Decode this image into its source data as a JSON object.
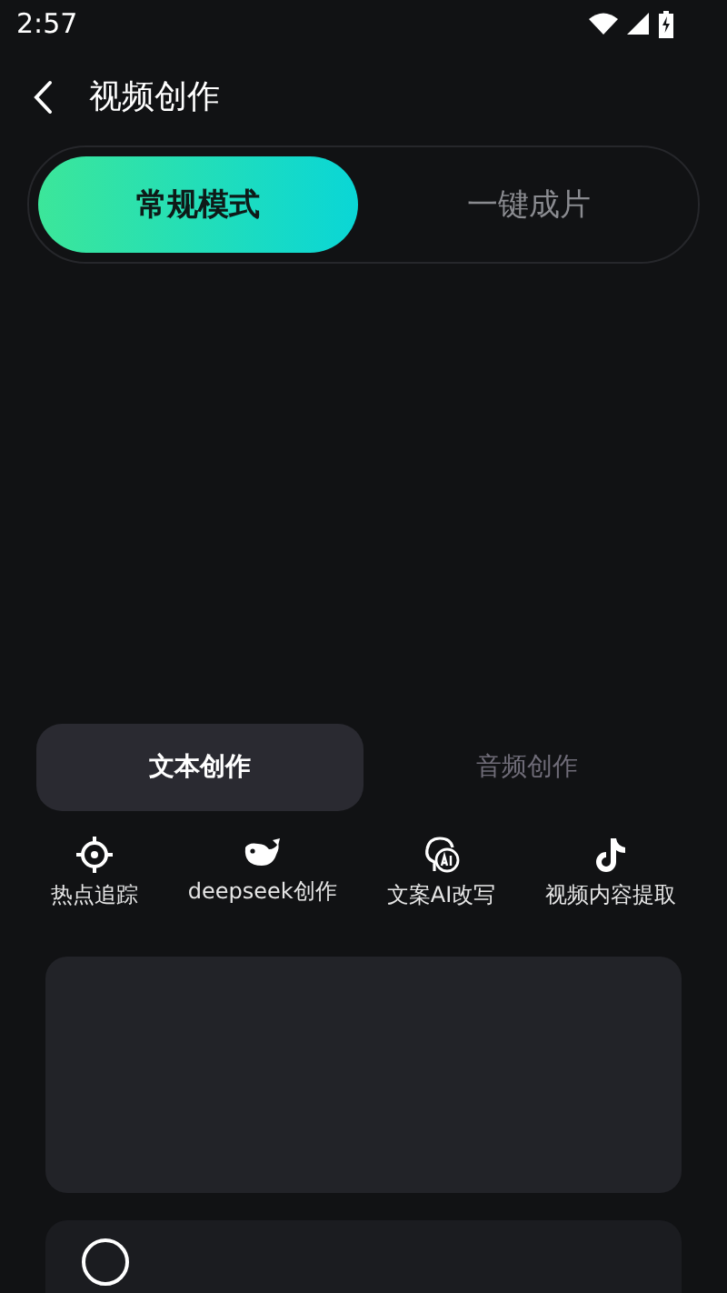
{
  "status_bar": {
    "time": "2:57"
  },
  "header": {
    "title": "视频创作"
  },
  "mode_tabs": [
    {
      "label": "常规模式",
      "selected": true
    },
    {
      "label": "一键成片",
      "selected": false
    }
  ],
  "sub_tabs": [
    {
      "label": "文本创作",
      "selected": true
    },
    {
      "label": "音频创作",
      "selected": false
    }
  ],
  "tools": [
    {
      "label": "热点追踪"
    },
    {
      "label": "deepseek创作"
    },
    {
      "label": "文案AI改写"
    },
    {
      "label": "视频内容提取"
    }
  ]
}
